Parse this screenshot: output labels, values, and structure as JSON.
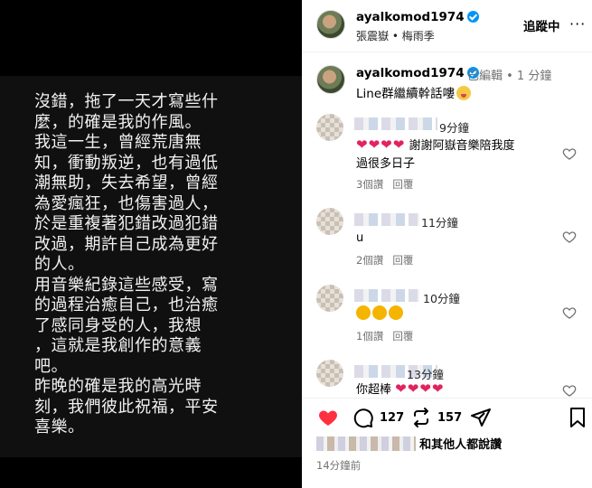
{
  "media": {
    "lines": [
      "沒錯，拖了一天才寫些什",
      "麼，的確是我的作風。",
      "我這一生，曾經荒唐無",
      "知，衝動叛逆，也有過低",
      "潮無助，失去希望，曾經",
      "為愛瘋狂，也傷害過人，",
      "於是重複著犯錯改過犯錯",
      "改過，期許自己成為更好",
      "的人。",
      "用音樂紀錄這些感受，寫",
      "的過程治癒自己，也治癒",
      "了感同身受的人，我想",
      "，這就是我創作的意義",
      "吧。",
      "昨晚的確是我的高光時",
      "刻，我們彼此祝福，平安",
      "喜樂。"
    ]
  },
  "header": {
    "username": "ayalkomod1974",
    "subtitle": "張震嶽 • 梅雨季",
    "follow_label": "追蹤中",
    "more_label": "···"
  },
  "caption": {
    "username": "ayalkomod1974",
    "edited": "已編輯 • 1 分鐘",
    "text": "Line群繼續幹話嘍"
  },
  "comments": [
    {
      "time": "9分鐘",
      "text_line1": "謝謝阿嶽音樂陪我度",
      "text_line2": "過很多日子",
      "likes": "3個讚",
      "reply": "回覆"
    },
    {
      "time": "11分鐘",
      "text_line1": "u",
      "likes": "2個讚",
      "reply": "回覆"
    },
    {
      "time": "10分鐘",
      "likes": "1個讚",
      "reply": "回覆"
    },
    {
      "time": "13分鐘",
      "text_line1": "你超棒"
    }
  ],
  "actions": {
    "like_count": "127",
    "repost_count": "157",
    "likes_text": "和其他人都說讚",
    "post_time": "14分鐘前"
  },
  "colors": {
    "accent": "#0095f6",
    "like_red": "#ff3040"
  }
}
